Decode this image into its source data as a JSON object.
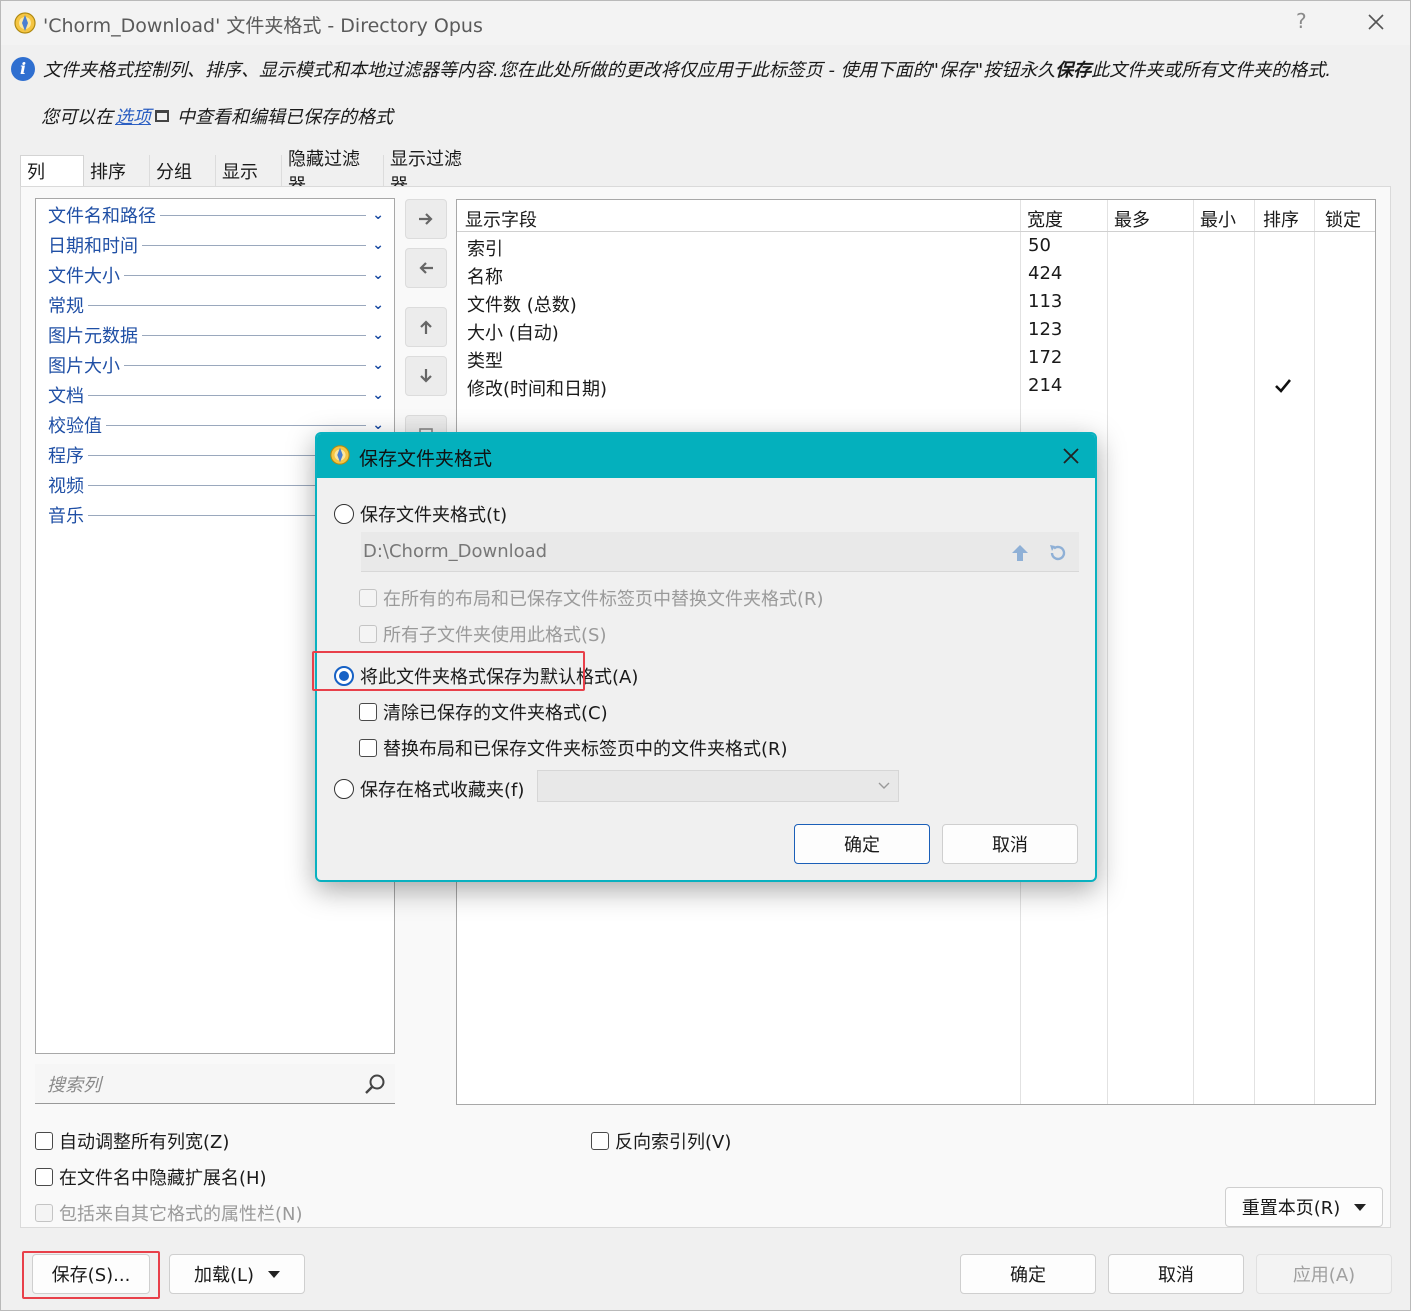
{
  "window": {
    "title": "'Chorm_Download' 文件夹格式 - Directory Opus",
    "help_label": "?"
  },
  "info": {
    "text_before": "文件夹格式控制列、排序、显示模式和本地过滤器等内容.您在此处所做的更改将仅应用于此标签页 - 使用下面的\"保存\"按钮永久",
    "text_bold": "保存",
    "text_after": "此文件夹或所有文件夹的格式.",
    "options_prefix": "您可以在",
    "options_link": "选项",
    "options_suffix": "中查看和编辑已保存的格式"
  },
  "tabs": [
    "列",
    "排序",
    "分组",
    "显示",
    "隐藏过滤器",
    "显示过滤器"
  ],
  "categories": [
    "文件名和路径",
    "日期和时间",
    "文件大小",
    "常规",
    "图片元数据",
    "图片大小",
    "文档",
    "校验值",
    "程序",
    "视频",
    "音乐"
  ],
  "search": {
    "placeholder": "搜索列"
  },
  "fields_table": {
    "headers": [
      "显示字段",
      "宽度",
      "最多",
      "最小",
      "排序",
      "锁定"
    ],
    "rows": [
      {
        "name": "索引",
        "width": "50",
        "sort_checked": false
      },
      {
        "name": "名称",
        "width": "424",
        "sort_checked": false
      },
      {
        "name": "文件数 (总数)",
        "width": "113",
        "sort_checked": false
      },
      {
        "name": "大小 (自动)",
        "width": "123",
        "sort_checked": false
      },
      {
        "name": "类型",
        "width": "172",
        "sort_checked": false
      },
      {
        "name": "修改(时间和日期)",
        "width": "214",
        "sort_checked": true
      }
    ]
  },
  "options": {
    "auto_width": "自动调整所有列宽(Z)",
    "hide_ext": "在文件名中隐藏扩展名(H)",
    "include_attrs": "包括来自其它格式的属性栏(N)",
    "reverse_index": "反向索引列(V)"
  },
  "buttons": {
    "reset_page": "重置本页(R)",
    "save": "保存(S)...",
    "load": "加载(L)",
    "ok": "确定",
    "cancel": "取消",
    "apply": "应用(A)"
  },
  "dialog": {
    "title": "保存文件夹格式",
    "opt_save_format": "保存文件夹格式(t)",
    "path_value": "D:\\Chorm_Download",
    "opt_replace_all_layouts": "在所有的布局和已保存文件标签页中替换文件夹格式(R)",
    "opt_all_subfolders": "所有子文件夹使用此格式(S)",
    "opt_save_default": "将此文件夹格式保存为默认格式(A)",
    "opt_clear_saved": "清除已保存的文件夹格式(C)",
    "opt_replace_layouts": "替换布局和已保存文件夹标签页中的文件夹格式(R)",
    "opt_save_favorites": "保存在格式收藏夹(f)",
    "ok": "确定",
    "cancel": "取消"
  },
  "colors": {
    "dialog_accent": "#04b0bd",
    "highlight_frame": "#e8404a",
    "link": "#2c5fc2",
    "category_text": "#1f4fa5"
  }
}
